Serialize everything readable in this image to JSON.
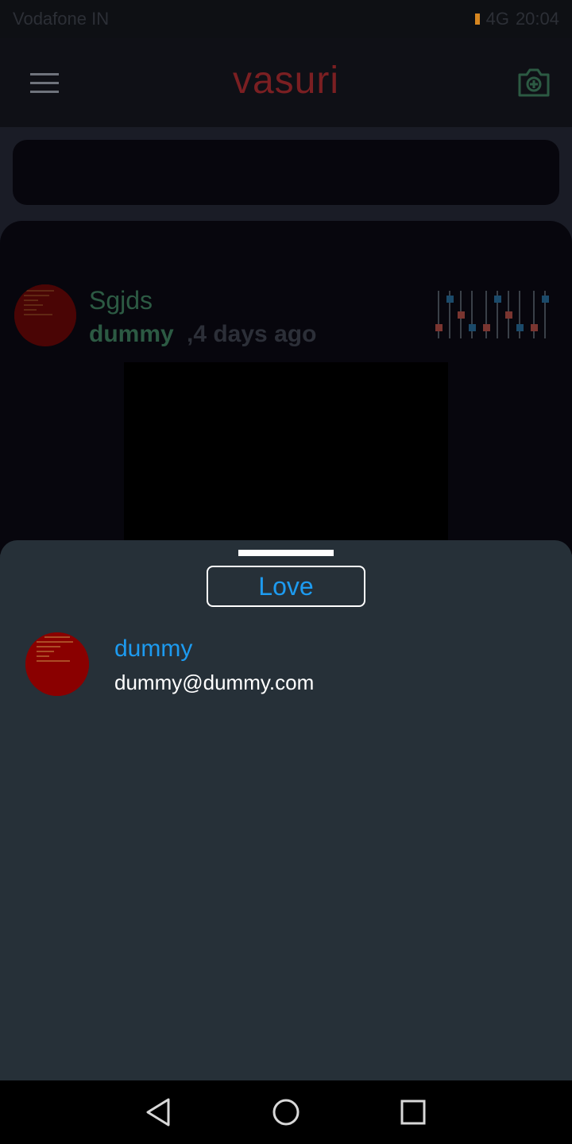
{
  "status_bar": {
    "carrier": "Vodafone IN",
    "network": "4G",
    "time": "20:04"
  },
  "app_bar": {
    "title": "vasuri",
    "menu_icon": "menu-icon",
    "camera_icon": "camera-add-icon"
  },
  "post": {
    "title": "Sgjds",
    "author": "dummy",
    "time_ago": ",4 days ago"
  },
  "sheet": {
    "reaction_label": "Love",
    "users": [
      {
        "name": "dummy",
        "email": "dummy@dummy.com"
      }
    ]
  },
  "nav": {
    "back_icon": "back-icon",
    "home_icon": "home-icon",
    "recents_icon": "recents-icon"
  },
  "colors": {
    "brand": "#7b1f22",
    "accent_blue": "#1d9bf0",
    "sheet_bg": "#263038",
    "post_green": "#2c5a43"
  }
}
